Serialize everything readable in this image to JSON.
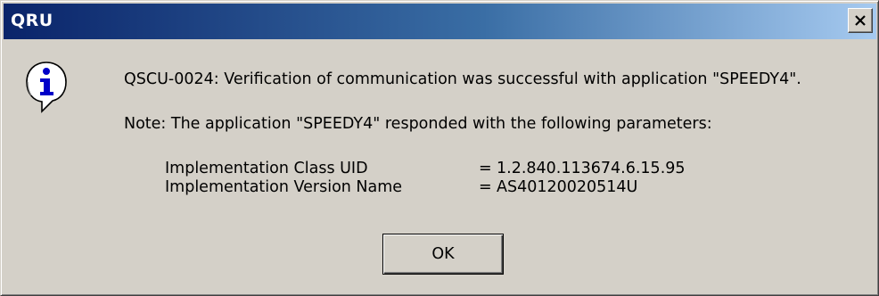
{
  "window": {
    "title": "QRU",
    "close_icon": "close-x-icon"
  },
  "message": {
    "icon": "information-icon",
    "main_text": "QSCU-0024:   Verification of communication was successful with application \"SPEEDY4\".",
    "note_text": "Note: The application \"SPEEDY4\" responded with the following parameters:",
    "parameters": [
      {
        "name": "Implementation Class UID",
        "separator": "=",
        "value": "1.2.840.113674.6.15.95"
      },
      {
        "name": "Implementation Version Name",
        "separator": "=",
        "value": "AS40120020514U"
      }
    ]
  },
  "buttons": {
    "ok_label": "OK"
  },
  "colors": {
    "dialog_face": "#d4d0c8",
    "titlebar_start": "#0a246a",
    "titlebar_end": "#a6caf0",
    "icon_accent": "#0000c8"
  }
}
